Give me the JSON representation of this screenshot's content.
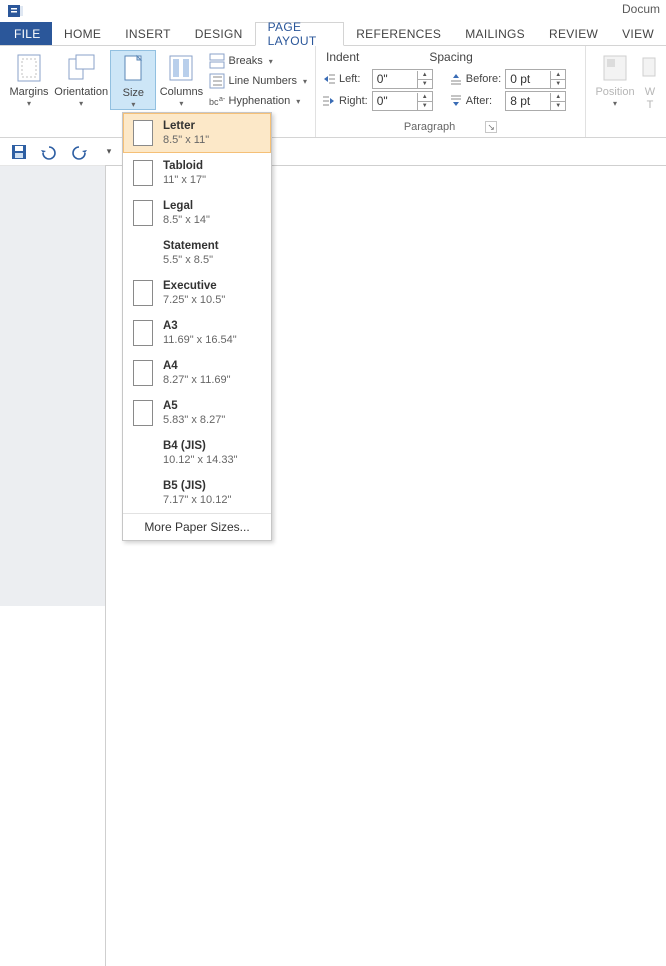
{
  "title_partial": "Docum",
  "tabs": {
    "file": "FILE",
    "items": [
      "HOME",
      "INSERT",
      "DESIGN",
      "PAGE LAYOUT",
      "REFERENCES",
      "MAILINGS",
      "REVIEW",
      "VIEW"
    ],
    "active_index": 3
  },
  "ribbon": {
    "pageSetup": {
      "margins": "Margins",
      "orientation": "Orientation",
      "size": "Size",
      "columns": "Columns",
      "breaks": "Breaks",
      "lineNumbers": "Line Numbers",
      "hyphenation": "Hyphenation",
      "groupLabel": ""
    },
    "paragraph": {
      "indentLabel": "Indent",
      "spacingLabel": "Spacing",
      "leftLabel": "Left:",
      "rightLabel": "Right:",
      "beforeLabel": "Before:",
      "afterLabel": "After:",
      "leftValue": "0\"",
      "rightValue": "0\"",
      "beforeValue": "0 pt",
      "afterValue": "8 pt",
      "groupLabel": "Paragraph"
    },
    "arrange": {
      "position": "Position",
      "wrap": "W\nT"
    }
  },
  "sizeMenu": {
    "items": [
      {
        "name": "Letter",
        "dim": "8.5\" x 11\"",
        "thumb": true,
        "selected": true
      },
      {
        "name": "Tabloid",
        "dim": "11\" x 17\"",
        "thumb": true,
        "selected": false
      },
      {
        "name": "Legal",
        "dim": "8.5\" x 14\"",
        "thumb": true,
        "selected": false
      },
      {
        "name": "Statement",
        "dim": "5.5\" x 8.5\"",
        "thumb": false,
        "selected": false
      },
      {
        "name": "Executive",
        "dim": "7.25\" x 10.5\"",
        "thumb": true,
        "selected": false
      },
      {
        "name": "A3",
        "dim": "11.69\" x 16.54\"",
        "thumb": true,
        "selected": false
      },
      {
        "name": "A4",
        "dim": "8.27\" x 11.69\"",
        "thumb": true,
        "selected": false
      },
      {
        "name": "A5",
        "dim": "5.83\" x 8.27\"",
        "thumb": true,
        "selected": false
      },
      {
        "name": "B4 (JIS)",
        "dim": "10.12\" x 14.33\"",
        "thumb": false,
        "selected": false
      },
      {
        "name": "B5 (JIS)",
        "dim": "7.17\" x 10.12\"",
        "thumb": false,
        "selected": false
      }
    ],
    "more": "More Paper Sizes..."
  }
}
